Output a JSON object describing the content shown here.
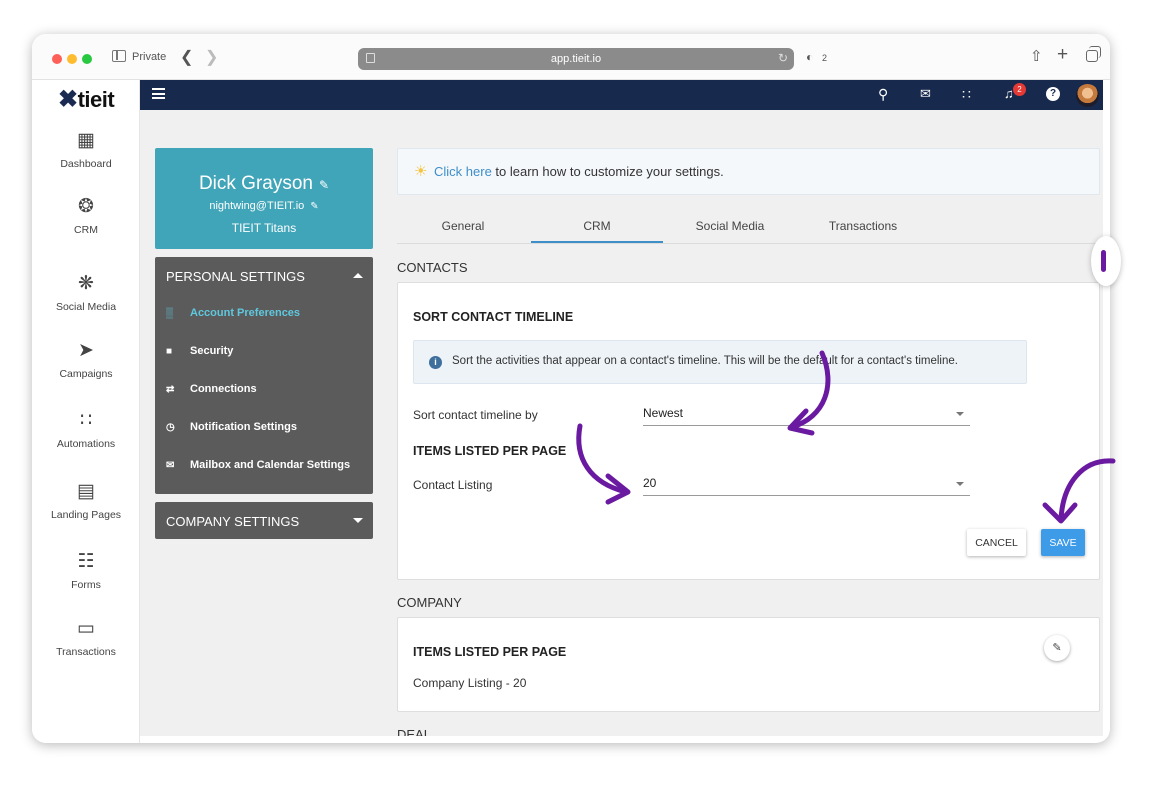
{
  "browser": {
    "private_label": "Private",
    "url": "app.tieit.io",
    "shield_count": "2"
  },
  "app": {
    "logo": "tieit",
    "notification_count": "2"
  },
  "left_nav": [
    {
      "label": "Dashboard",
      "icon": "dashboard-icon"
    },
    {
      "label": "CRM",
      "icon": "crm-icon"
    },
    {
      "label": "Social Media",
      "icon": "social-media-icon"
    },
    {
      "label": "Campaigns",
      "icon": "send-icon"
    },
    {
      "label": "Automations",
      "icon": "automations-icon"
    },
    {
      "label": "Landing Pages",
      "icon": "landing-pages-icon"
    },
    {
      "label": "Forms",
      "icon": "forms-icon"
    },
    {
      "label": "Transactions",
      "icon": "card-icon"
    }
  ],
  "profile": {
    "name": "Dick Grayson",
    "email": "nightwing@TIEIT.io",
    "team": "TIEIT Titans"
  },
  "personal_settings": {
    "header": "PERSONAL SETTINGS",
    "items": [
      {
        "label": "Account Preferences",
        "icon": "bank-icon",
        "active": true
      },
      {
        "label": "Security",
        "icon": "lock-icon",
        "active": false
      },
      {
        "label": "Connections",
        "icon": "swap-icon",
        "active": false
      },
      {
        "label": "Notification Settings",
        "icon": "alarm-icon",
        "active": false
      },
      {
        "label": "Mailbox and Calendar Settings",
        "icon": "mail-icon",
        "active": false
      }
    ]
  },
  "company_settings": {
    "header": "COMPANY SETTINGS"
  },
  "banner": {
    "link": "Click here",
    "text": " to learn how to customize your settings."
  },
  "tabs": [
    {
      "label": "General"
    },
    {
      "label": "CRM",
      "active": true
    },
    {
      "label": "Social Media"
    },
    {
      "label": "Transactions"
    }
  ],
  "contacts": {
    "section_label": "CONTACTS",
    "sort_title": "SORT CONTACT TIMELINE",
    "note": "Sort the activities that appear on a contact's timeline. This will be the default for a contact's timeline.",
    "sort_label": "Sort contact timeline by",
    "sort_value": "Newest",
    "items_title": "ITEMS LISTED PER PAGE",
    "listing_label": "Contact Listing",
    "listing_value": "20",
    "cancel_label": "CANCEL",
    "save_label": "SAVE"
  },
  "company": {
    "section_label": "COMPANY",
    "items_title": "ITEMS LISTED PER PAGE",
    "listing_text": "Company Listing - 20"
  },
  "deal": {
    "section_label": "DEAL"
  },
  "colors": {
    "topbar": "#17294d",
    "profile_card": "#40a5b8",
    "settings_panel": "#5b5b5b",
    "active_item": "#5fc8df",
    "save_button": "#3e9be8",
    "annotation_arrow": "#6a1aa0"
  }
}
